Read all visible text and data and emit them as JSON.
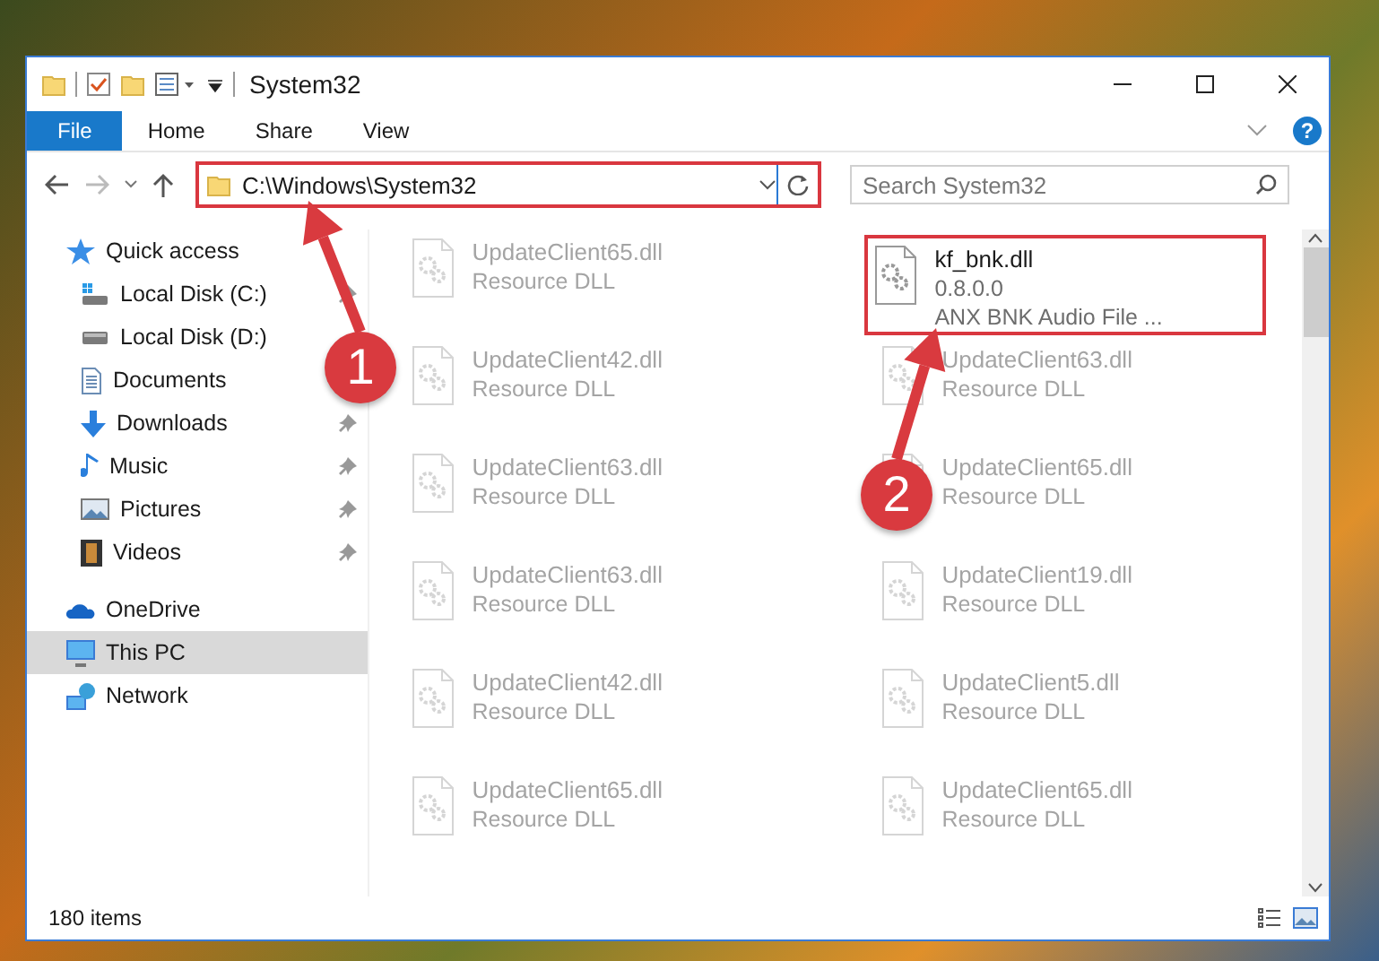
{
  "window": {
    "title": "System32"
  },
  "ribbon_tabs": [
    {
      "label": "File",
      "kind": "file",
      "selected": false
    },
    {
      "label": "Home",
      "kind": "tab",
      "selected": false
    },
    {
      "label": "Share",
      "kind": "tab",
      "selected": false
    },
    {
      "label": "View",
      "kind": "tab",
      "selected": false
    }
  ],
  "help_button": "?",
  "address_bar": {
    "value": "C:\\Windows\\System32"
  },
  "search": {
    "placeholder": "Search System32"
  },
  "navigation": [
    {
      "label": "Quick access",
      "kind": "star",
      "pinned": false,
      "selected": false,
      "children": [
        {
          "label": "Local Disk (C:)",
          "kind": "system-drive",
          "pinned": true,
          "selected": false
        },
        {
          "label": "Local Disk (D:)",
          "kind": "drive",
          "pinned": false,
          "selected": false
        },
        {
          "label": "Documents",
          "kind": "documents",
          "pinned": false,
          "selected": false
        },
        {
          "label": "Downloads",
          "kind": "downloads",
          "pinned": true,
          "selected": false
        },
        {
          "label": "Music",
          "kind": "music",
          "pinned": true,
          "selected": false
        },
        {
          "label": "Pictures",
          "kind": "pictures",
          "pinned": true,
          "selected": false
        },
        {
          "label": "Videos",
          "kind": "videos",
          "pinned": true,
          "selected": false
        }
      ]
    },
    {
      "label": "OneDrive",
      "kind": "cloud",
      "pinned": false,
      "selected": false
    },
    {
      "label": "This PC",
      "kind": "computer",
      "pinned": false,
      "selected": true
    },
    {
      "label": "Network",
      "kind": "network",
      "pinned": false,
      "selected": false
    }
  ],
  "files": [
    {
      "name": "UpdateClient65.dll",
      "details": [
        "Resource DLL"
      ],
      "faded": true
    },
    {
      "name": "kf_bnk.dll",
      "details": [
        "0.8.0.0",
        "ANX BNK Audio File ..."
      ],
      "faded": false
    },
    {
      "name": "UpdateClient42.dll",
      "details": [
        "Resource DLL"
      ],
      "faded": true
    },
    {
      "name": "UpdateClient63.dll",
      "details": [
        "Resource DLL"
      ],
      "faded": true
    },
    {
      "name": "UpdateClient63.dll",
      "details": [
        "Resource DLL"
      ],
      "faded": true
    },
    {
      "name": "UpdateClient65.dll",
      "details": [
        "Resource DLL"
      ],
      "faded": true
    },
    {
      "name": "UpdateClient63.dll",
      "details": [
        "Resource DLL"
      ],
      "faded": true
    },
    {
      "name": "UpdateClient19.dll",
      "details": [
        "Resource DLL"
      ],
      "faded": true
    },
    {
      "name": "UpdateClient42.dll",
      "details": [
        "Resource DLL"
      ],
      "faded": true
    },
    {
      "name": "UpdateClient5.dll",
      "details": [
        "Resource DLL"
      ],
      "faded": true
    },
    {
      "name": "UpdateClient65.dll",
      "details": [
        "Resource DLL"
      ],
      "faded": true
    },
    {
      "name": "UpdateClient65.dll",
      "details": [
        "Resource DLL"
      ],
      "faded": true
    }
  ],
  "annotations": [
    {
      "label": "1"
    },
    {
      "label": "2"
    }
  ],
  "status_bar": {
    "item_count": "180 items"
  }
}
